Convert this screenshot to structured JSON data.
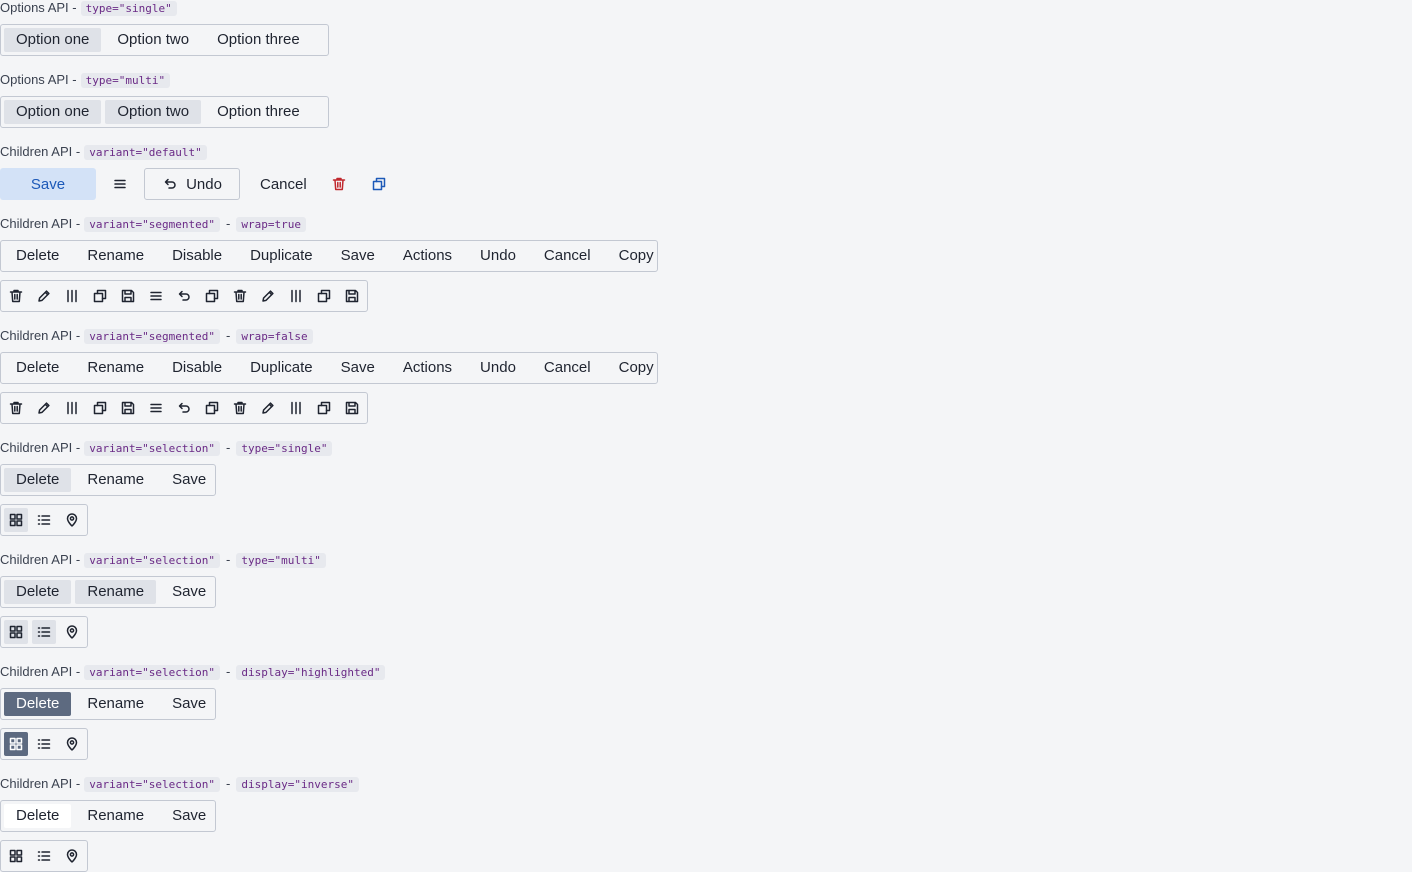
{
  "labels": {
    "l1": {
      "api": "Options API -",
      "code1": "type=\"single\""
    },
    "l2": {
      "api": "Options API -",
      "code1": "type=\"multi\""
    },
    "l3": {
      "api": "Children API -",
      "code1": "variant=\"default\""
    },
    "l4": {
      "api": "Children API -",
      "code1": "variant=\"segmented\"",
      "sep": "-",
      "code2": "wrap=true"
    },
    "l5": {
      "api": "Children API -",
      "code1": "variant=\"segmented\"",
      "sep": "-",
      "code2": "wrap=false"
    },
    "l6": {
      "api": "Children API -",
      "code1": "variant=\"selection\"",
      "sep": "-",
      "code2": "type=\"single\""
    },
    "l7": {
      "api": "Children API -",
      "code1": "variant=\"selection\"",
      "sep": "-",
      "code2": "type=\"multi\""
    },
    "l8": {
      "api": "Children API -",
      "code1": "variant=\"selection\"",
      "sep": "-",
      "code2": "display=\"highlighted\""
    },
    "l9": {
      "api": "Children API -",
      "code1": "variant=\"selection\"",
      "sep": "-",
      "code2": "display=\"inverse\""
    }
  },
  "options": [
    "Option one",
    "Option two",
    "Option three"
  ],
  "default_row": {
    "save": "Save",
    "undo": "Undo",
    "cancel": "Cancel"
  },
  "segmented": [
    "Delete",
    "Rename",
    "Disable",
    "Duplicate",
    "Save",
    "Actions",
    "Undo",
    "Cancel",
    "Copy"
  ],
  "selection": [
    "Delete",
    "Rename",
    "Save"
  ],
  "icons": {
    "segmented": [
      "trash-icon",
      "pencil-icon",
      "columns-icon",
      "copy-icon",
      "save-icon",
      "menu-icon",
      "undo-icon",
      "copy-icon",
      "trash-icon",
      "pencil-icon",
      "columns-icon",
      "copy-icon",
      "save-icon"
    ],
    "selection": [
      "grid-icon",
      "list-icon",
      "location-icon"
    ]
  },
  "colors": {
    "save_bg": "#d3e2f7",
    "save_text": "#1c59b8",
    "danger": "#c0272d",
    "link": "#1c59b8",
    "highlight": "#5d6a80",
    "selected": "#dfe2e8"
  }
}
